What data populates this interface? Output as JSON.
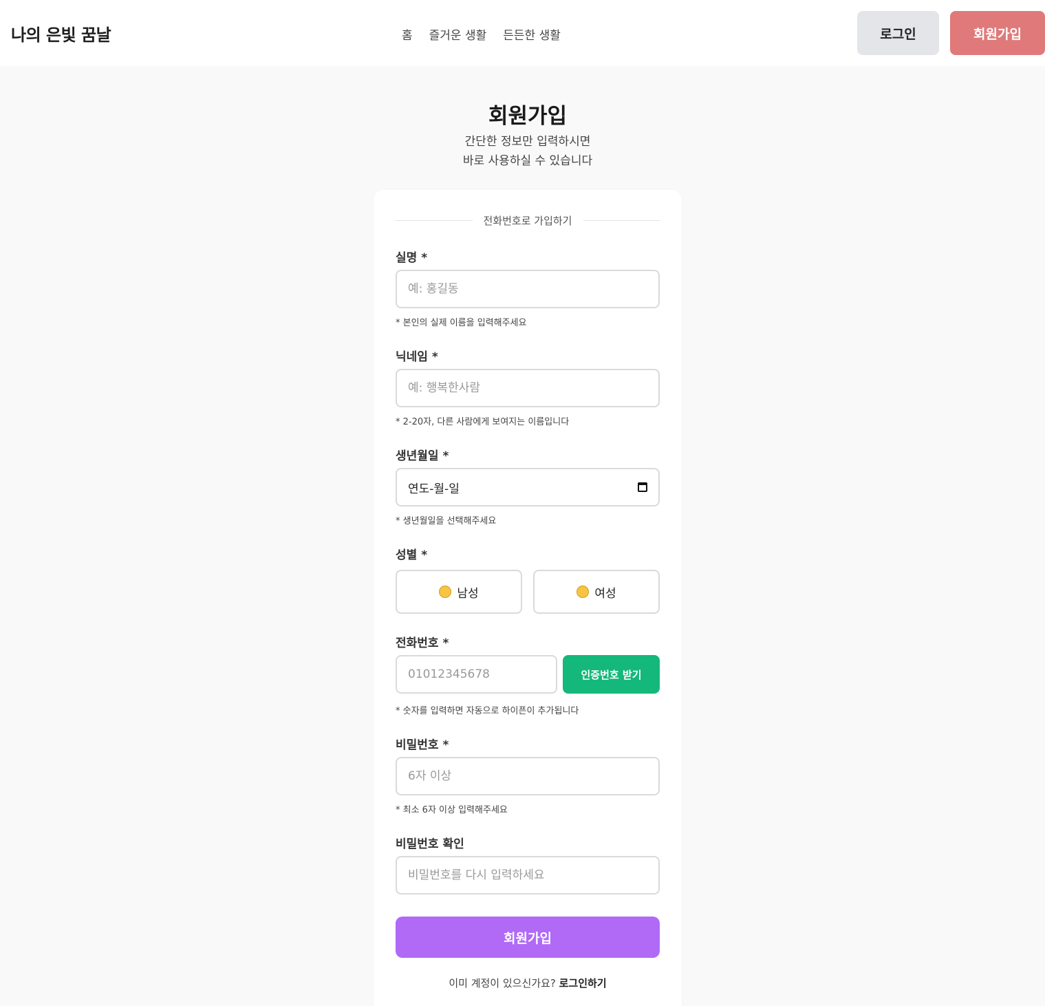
{
  "header": {
    "logo": "나의 은빛 꿈날",
    "nav": [
      "홈",
      "즐거운 생활",
      "든든한 생활"
    ],
    "login_label": "로그인",
    "signup_label": "회원가입"
  },
  "page": {
    "title": "회원가입",
    "subtitle_line1": "간단한 정보만 입력하시면",
    "subtitle_line2": "바로 사용하실 수 있습니다"
  },
  "form": {
    "section_label": "전화번호로 가입하기",
    "name": {
      "label": "실명 *",
      "placeholder": "예: 홍길동",
      "hint": "* 본인의 실제 이름을 입력해주세요"
    },
    "nickname": {
      "label": "닉네임 *",
      "placeholder": "예: 행복한사람",
      "hint": "* 2-20자, 다른 사람에게 보여지는 이름입니다"
    },
    "birth": {
      "label": "생년월일 *",
      "value": "연도-월-일",
      "hint": "* 생년월일을 선택해주세요"
    },
    "gender": {
      "label": "성별 *",
      "male": "남성",
      "female": "여성"
    },
    "phone": {
      "label": "전화번호 *",
      "placeholder": "01012345678",
      "verify_label": "인증번호 받기",
      "hint": "* 숫자를 입력하면 자동으로 하이픈이 추가됩니다"
    },
    "password": {
      "label": "비밀번호 *",
      "placeholder": "6자 이상",
      "hint": "* 최소 6자 이상 입력해주세요"
    },
    "password_confirm": {
      "label": "비밀번호 확인",
      "placeholder": "비밀번호를 다시 입력하세요"
    },
    "submit_label": "회원가입",
    "already_text": "이미 계정이 있으신가요?",
    "login_link": "로그인하기"
  },
  "colors": {
    "signup_top": "#e07a7a",
    "verify": "#14b87a",
    "submit": "#b06af5"
  },
  "icons": [
    "calendar-icon",
    "male-emoji-icon",
    "female-emoji-icon"
  ]
}
